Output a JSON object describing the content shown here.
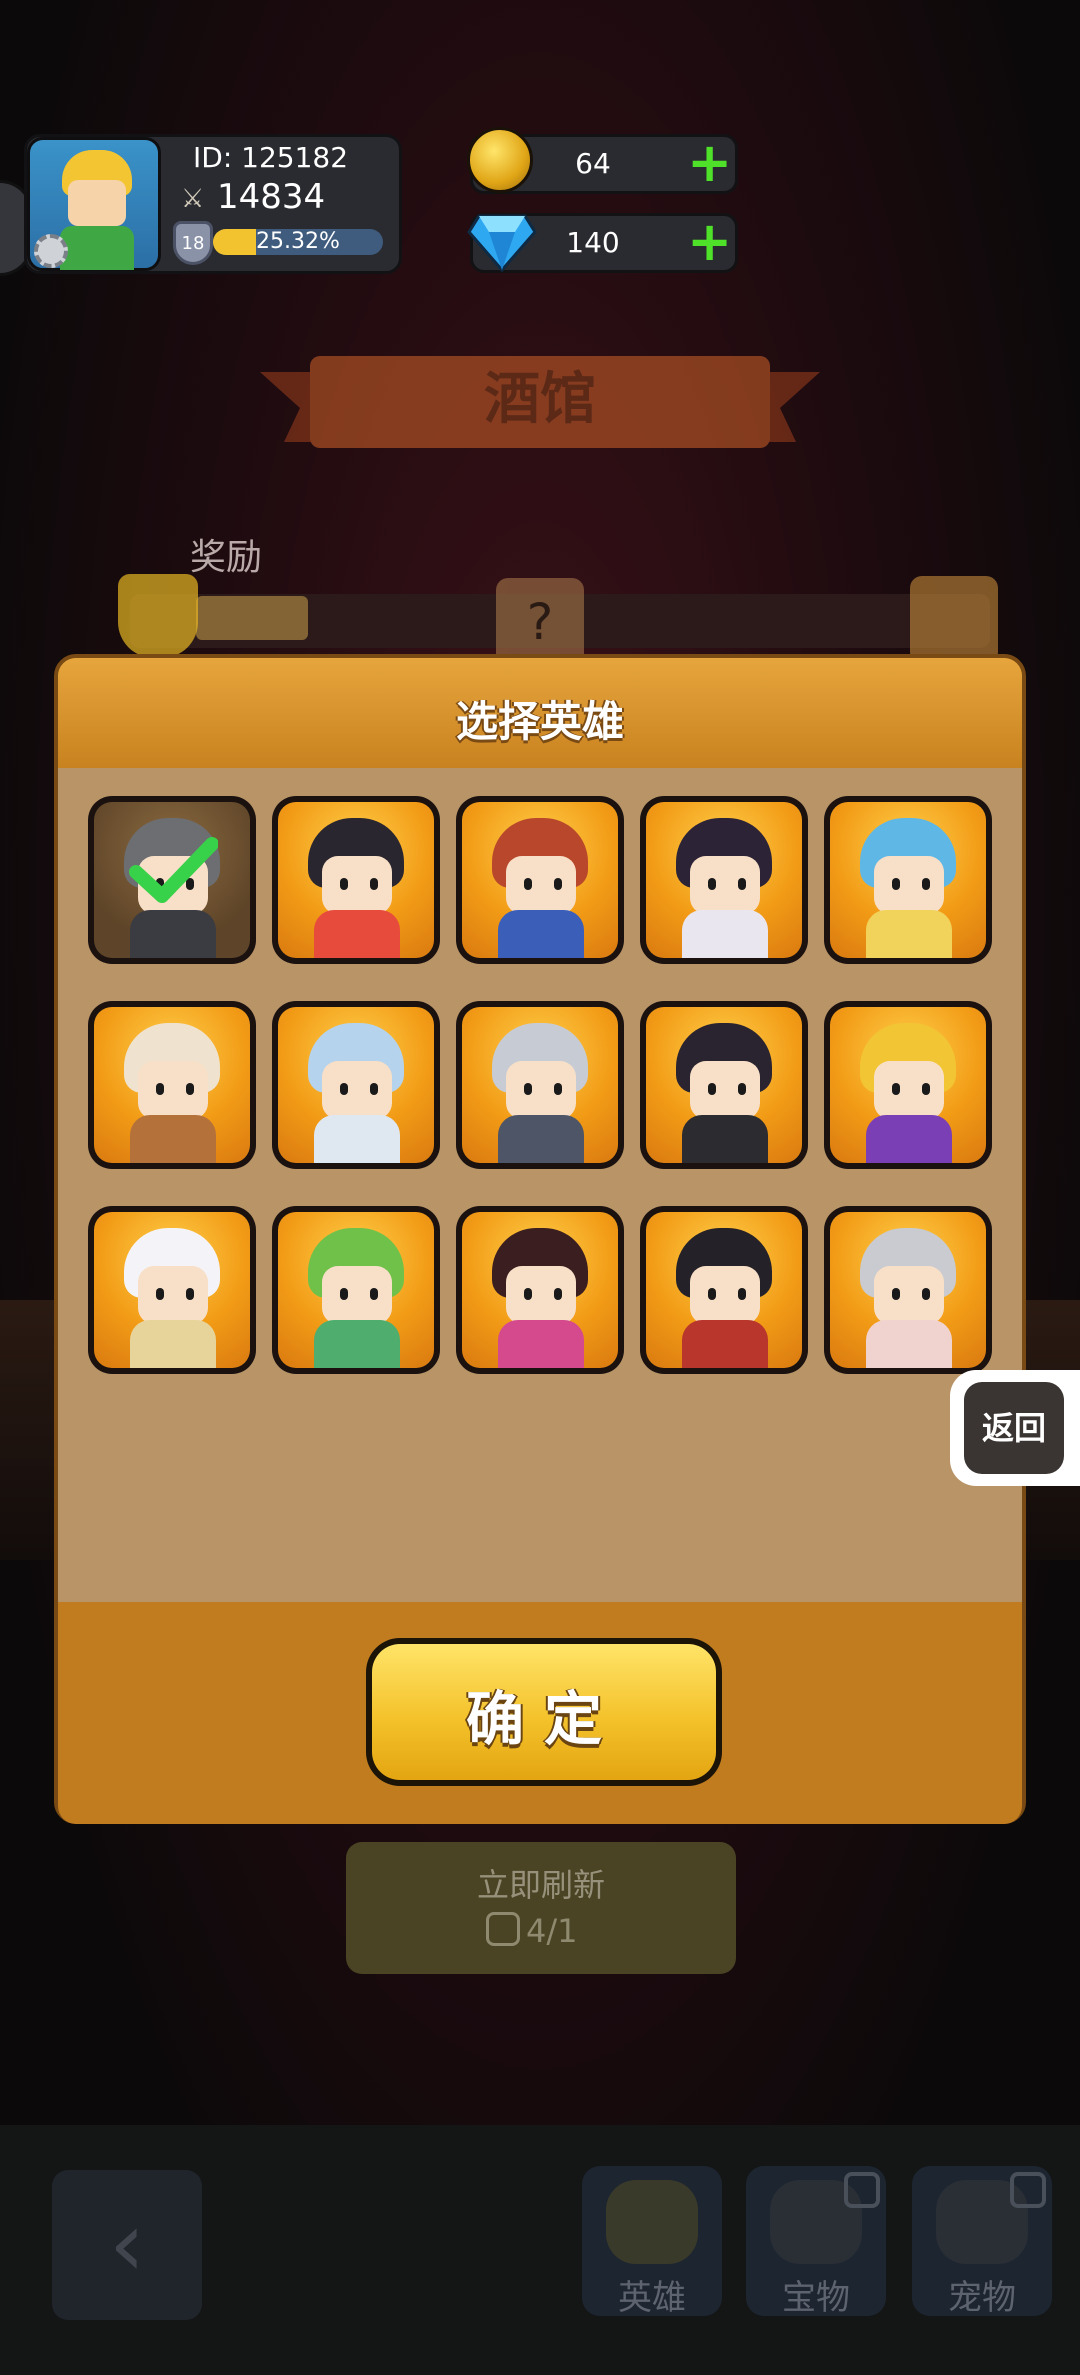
{
  "header": {
    "player_id": "ID:  125182",
    "power": "14834",
    "level": "18",
    "exp_percent": "25.32%",
    "exp_fraction": 0.2532,
    "gold": "64",
    "diamonds": "140"
  },
  "tavern": {
    "title": "酒馆",
    "reward_label": "奖励",
    "refresh_label": "立即刷新",
    "refresh_count": "4/1"
  },
  "modal": {
    "title": "选择英雄",
    "confirm_label": "确定",
    "heroes": [
      {
        "hair": "#6c6e72",
        "body": "#3a3c42",
        "selected": true
      },
      {
        "hair": "#2a2630",
        "body": "#e64b3c",
        "selected": false
      },
      {
        "hair": "#b8472b",
        "body": "#3b5fb8",
        "selected": false
      },
      {
        "hair": "#2c2436",
        "body": "#e9e6f0",
        "selected": false
      },
      {
        "hair": "#5fb7e6",
        "body": "#f1d35c",
        "selected": false
      },
      {
        "hair": "#efe3cf",
        "body": "#b4723a",
        "selected": false
      },
      {
        "hair": "#b5d3ec",
        "body": "#dfe8f1",
        "selected": false
      },
      {
        "hair": "#c7ccd4",
        "body": "#4d5567",
        "selected": false
      },
      {
        "hair": "#2a2430",
        "body": "#2b2b30",
        "selected": false
      },
      {
        "hair": "#f2c534",
        "body": "#7a3fb4",
        "selected": false
      },
      {
        "hair": "#f4f4f8",
        "body": "#e6d49a",
        "selected": false
      },
      {
        "hair": "#6fc14a",
        "body": "#4fae6e",
        "selected": false
      },
      {
        "hair": "#3a1e20",
        "body": "#d44a8c",
        "selected": false
      },
      {
        "hair": "#242228",
        "body": "#b8362c",
        "selected": false
      },
      {
        "hair": "#c9cbd0",
        "body": "#f0d2cf",
        "selected": false
      }
    ]
  },
  "side": {
    "back_label": "返回"
  },
  "nav": {
    "tab_heroes": "英雄",
    "tab_treasures": "宝物",
    "tab_pets": "宠物"
  }
}
